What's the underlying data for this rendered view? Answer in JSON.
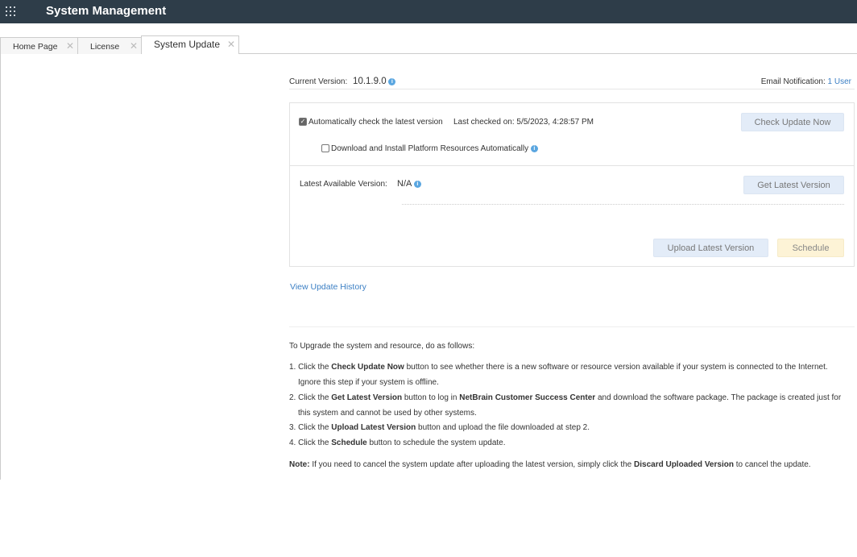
{
  "header": {
    "title": "System Management"
  },
  "tabs": [
    {
      "label": "Home Page"
    },
    {
      "label": "License"
    },
    {
      "label": "System Update"
    }
  ],
  "version": {
    "label": "Current Version:",
    "value": "10.1.9.0",
    "email_label": "Email Notification:",
    "email_link": "1 User"
  },
  "check": {
    "auto_label": "Automatically check the latest version",
    "auto_checked": true,
    "last_checked": "Last checked on: 5/5/2023, 4:28:57 PM",
    "check_button": "Check Update Now",
    "download_label": "Download and Install Platform Resources Automatically",
    "download_checked": false
  },
  "latest": {
    "label": "Latest Available Version:",
    "value": "N/A",
    "get_button": "Get Latest Version",
    "upload_button": "Upload Latest Version",
    "schedule_button": "Schedule"
  },
  "history_link": "View Update History",
  "instructions": {
    "intro": "To Upgrade the system and resource, do as follows:",
    "steps": [
      [
        {
          "t": "1. Click the "
        },
        {
          "b": "Check Update Now"
        },
        {
          "t": " button to see whether there is a new software or resource version available if your system is connected to the Internet. Ignore this step if your system is offline."
        }
      ],
      [
        {
          "t": "2. Click the "
        },
        {
          "b": "Get Latest Version"
        },
        {
          "t": " button to log in "
        },
        {
          "b": "NetBrain Customer Success Center"
        },
        {
          "t": " and download the software package. The package is created just for this system and cannot be used by other systems."
        }
      ],
      [
        {
          "t": "3. Click the "
        },
        {
          "b": "Upload Latest Version"
        },
        {
          "t": " button and upload the file downloaded at step 2."
        }
      ],
      [
        {
          "t": "4. Click the "
        },
        {
          "b": "Schedule"
        },
        {
          "t": " button to schedule the system update."
        }
      ]
    ],
    "note": [
      {
        "b": "Note:"
      },
      {
        "t": " If you need to cancel the system update after uploading the latest version, simply click the "
      },
      {
        "b": "Discard Uploaded Version"
      },
      {
        "t": " to cancel the update."
      }
    ]
  }
}
